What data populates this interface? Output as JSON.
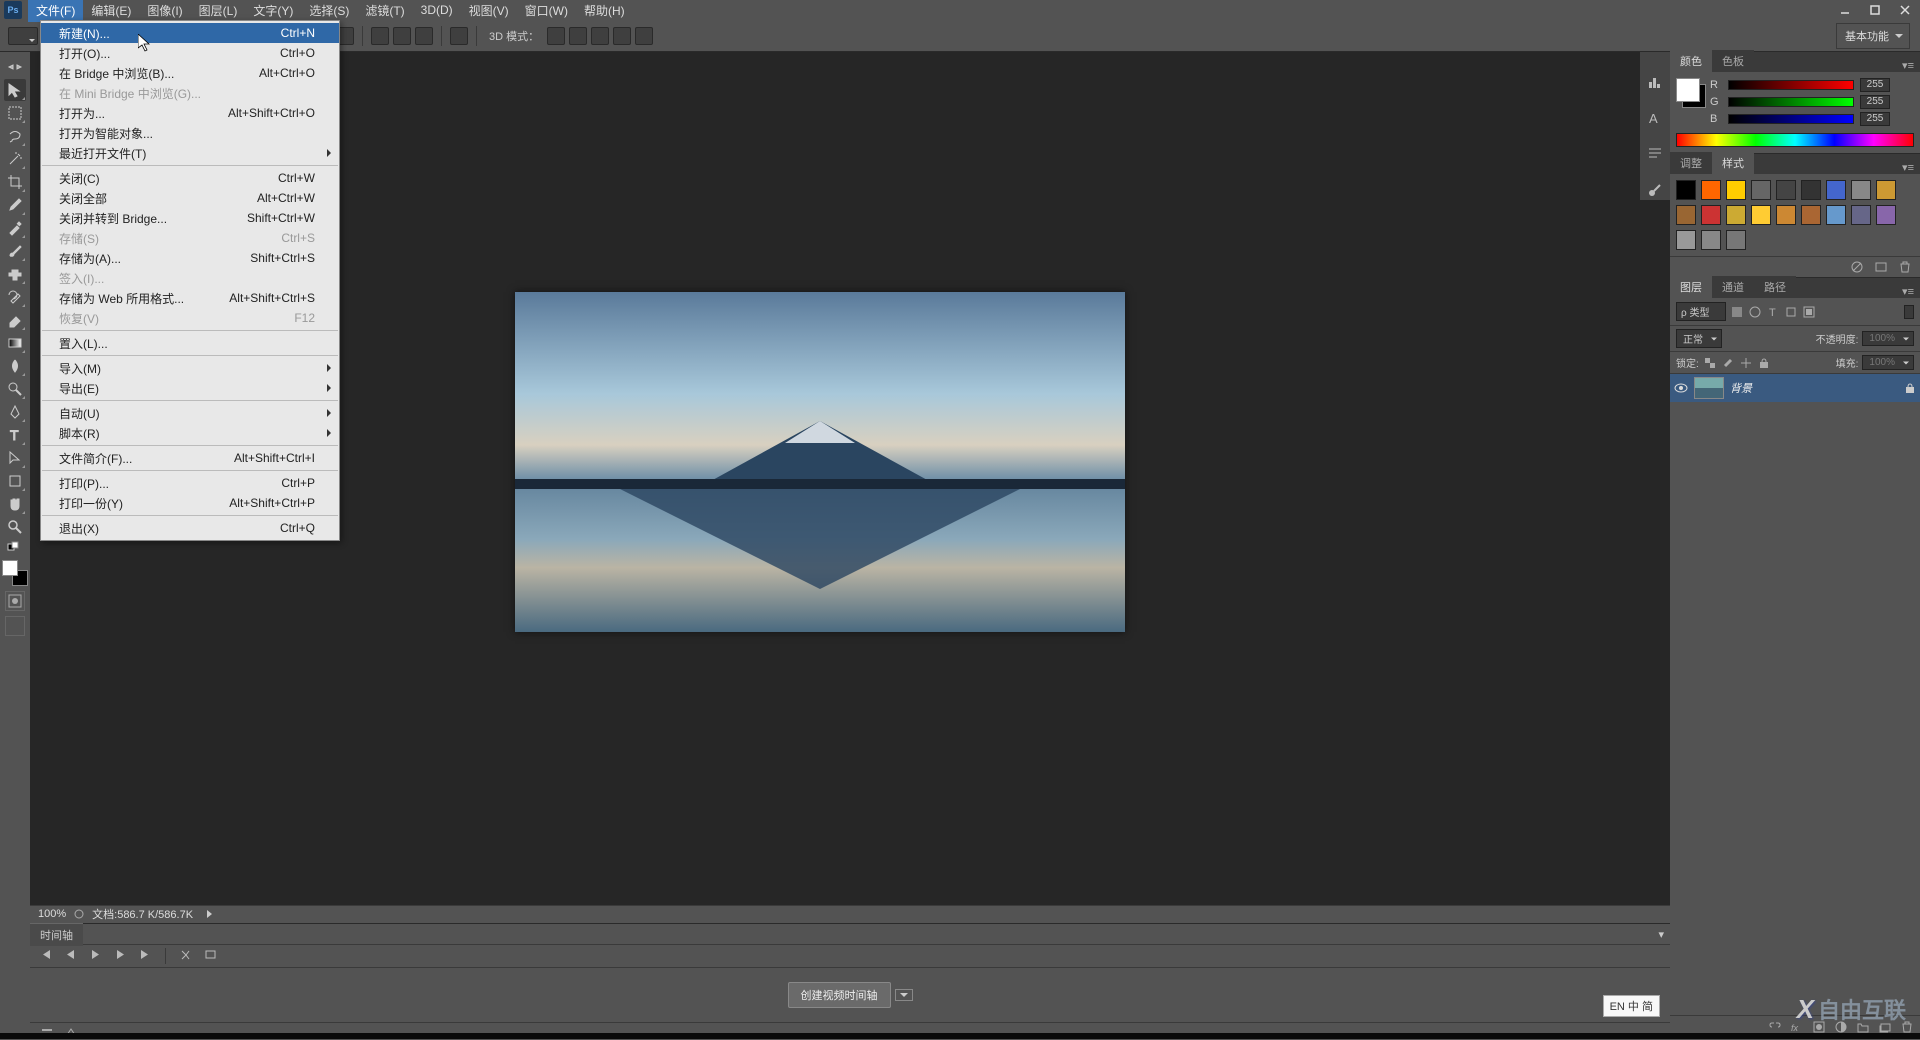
{
  "menubar": {
    "items": [
      "文件(F)",
      "编辑(E)",
      "图像(I)",
      "图层(L)",
      "文字(Y)",
      "选择(S)",
      "滤镜(T)",
      "3D(D)",
      "视图(V)",
      "窗口(W)",
      "帮助(H)"
    ]
  },
  "dropdown": {
    "items": [
      {
        "label": "新建(N)...",
        "shortcut": "Ctrl+N",
        "highlighted": true
      },
      {
        "label": "打开(O)...",
        "shortcut": "Ctrl+O"
      },
      {
        "label": "在 Bridge 中浏览(B)...",
        "shortcut": "Alt+Ctrl+O"
      },
      {
        "label": "在 Mini Bridge 中浏览(G)...",
        "shortcut": "",
        "disabled": true
      },
      {
        "label": "打开为...",
        "shortcut": "Alt+Shift+Ctrl+O"
      },
      {
        "label": "打开为智能对象...",
        "shortcut": ""
      },
      {
        "label": "最近打开文件(T)",
        "shortcut": "",
        "submenu": true
      },
      {
        "sep": true
      },
      {
        "label": "关闭(C)",
        "shortcut": "Ctrl+W"
      },
      {
        "label": "关闭全部",
        "shortcut": "Alt+Ctrl+W"
      },
      {
        "label": "关闭并转到 Bridge...",
        "shortcut": "Shift+Ctrl+W"
      },
      {
        "label": "存储(S)",
        "shortcut": "Ctrl+S",
        "disabled": true
      },
      {
        "label": "存储为(A)...",
        "shortcut": "Shift+Ctrl+S"
      },
      {
        "label": "签入(I)...",
        "shortcut": "",
        "disabled": true
      },
      {
        "label": "存储为 Web 所用格式...",
        "shortcut": "Alt+Shift+Ctrl+S"
      },
      {
        "label": "恢复(V)",
        "shortcut": "F12",
        "disabled": true
      },
      {
        "sep": true
      },
      {
        "label": "置入(L)...",
        "shortcut": ""
      },
      {
        "sep": true
      },
      {
        "label": "导入(M)",
        "shortcut": "",
        "submenu": true
      },
      {
        "label": "导出(E)",
        "shortcut": "",
        "submenu": true
      },
      {
        "sep": true
      },
      {
        "label": "自动(U)",
        "shortcut": "",
        "submenu": true
      },
      {
        "label": "脚本(R)",
        "shortcut": "",
        "submenu": true
      },
      {
        "sep": true
      },
      {
        "label": "文件简介(F)...",
        "shortcut": "Alt+Shift+Ctrl+I"
      },
      {
        "sep": true
      },
      {
        "label": "打印(P)...",
        "shortcut": "Ctrl+P"
      },
      {
        "label": "打印一份(Y)",
        "shortcut": "Alt+Shift+Ctrl+P"
      },
      {
        "sep": true
      },
      {
        "label": "退出(X)",
        "shortcut": "Ctrl+Q"
      }
    ]
  },
  "options_bar": {
    "mode_label": "3D 模式：",
    "workspace": "基本功能"
  },
  "status": {
    "zoom": "100%",
    "doc_info": "文档:586.7 K/586.7K"
  },
  "timeline": {
    "tab": "时间轴",
    "create_btn": "创建视频时间轴"
  },
  "color_panel": {
    "tab1": "颜色",
    "tab2": "色板",
    "r_label": "R",
    "r_val": "255",
    "g_label": "G",
    "g_val": "255",
    "b_label": "B",
    "b_val": "255"
  },
  "adjust_panel": {
    "tab1": "调整",
    "tab2": "样式"
  },
  "swatches": [
    "#000000",
    "#ff6600",
    "#ffcc00",
    "#666666",
    "#444444",
    "#333333",
    "#4466cc",
    "#888888",
    "#cc9933",
    "#996633",
    "#cc3333",
    "#ccaa33",
    "#ffcc33",
    "#cc8833",
    "#aa6633",
    "#6699cc",
    "#666688",
    "#8866aa",
    "#999999",
    "#888888",
    "#777777"
  ],
  "layers_panel": {
    "tab1": "图层",
    "tab2": "通道",
    "tab3": "路径",
    "kind_label": "ρ 类型",
    "blend_mode": "正常",
    "opacity_label": "不透明度:",
    "opacity_val": "100%",
    "lock_label": "锁定:",
    "fill_label": "填充:",
    "fill_val": "100%",
    "layer_name": "背景"
  },
  "ime": "EN 中 简",
  "watermark": "自由互联"
}
